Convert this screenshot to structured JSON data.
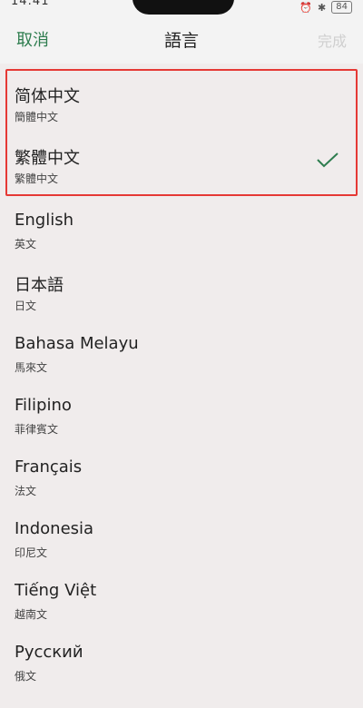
{
  "status_bar": {
    "time": "14:41",
    "battery": "84"
  },
  "header": {
    "cancel_label": "取消",
    "title": "語言",
    "done_label": "完成"
  },
  "languages": [
    {
      "name": "简体中文",
      "native": "簡體中文",
      "selected": false
    },
    {
      "name": "繁體中文",
      "native": "繁體中文",
      "selected": true
    },
    {
      "name": "English",
      "native": "英文",
      "selected": false
    },
    {
      "name": "日本語",
      "native": "日文",
      "selected": false
    },
    {
      "name": "Bahasa Melayu",
      "native": "馬來文",
      "selected": false
    },
    {
      "name": "Filipino",
      "native": "菲律賓文",
      "selected": false
    },
    {
      "name": "Français",
      "native": "法文",
      "selected": false
    },
    {
      "name": "Indonesia",
      "native": "印尼文",
      "selected": false
    },
    {
      "name": "Tiếng Việt",
      "native": "越南文",
      "selected": false
    },
    {
      "name": "Русский",
      "native": "俄文",
      "selected": false
    }
  ],
  "colors": {
    "accent": "#2e7d4f",
    "highlight_border": "#e53935",
    "check": "#2e7d4f"
  },
  "icons": {
    "selected_mark": "checkmark-icon",
    "bluetooth": "bluetooth-icon",
    "alarm": "alarm-icon"
  }
}
